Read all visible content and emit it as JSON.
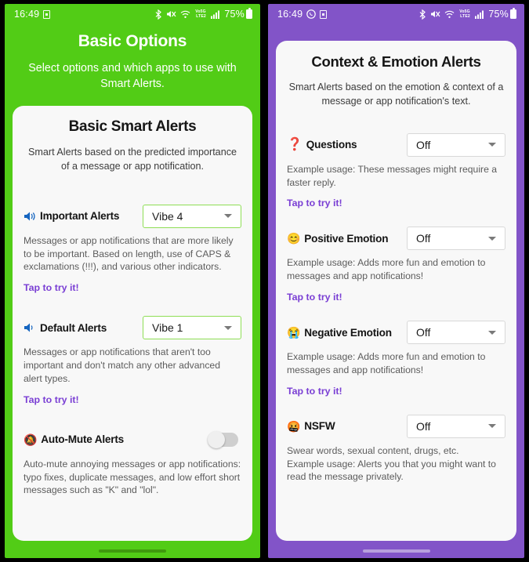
{
  "screens": [
    {
      "id": "basic-options",
      "accent": "#52cc16",
      "status": {
        "clock": "16:49",
        "battery": "75%",
        "network": "Vo5G LTE2 R",
        "icons": [
          "bluetooth-icon",
          "mute-icon",
          "wifi-icon",
          "signal-icon",
          "battery-icon"
        ]
      },
      "header": {
        "title": "Basic Options",
        "subtitle": "Select options and which apps to use with Smart Alerts."
      },
      "card": {
        "title": "Basic Smart Alerts",
        "subtitle": "Smart Alerts based on the predicted importance of a message or app notification."
      },
      "options": [
        {
          "icon": "speaker-loud",
          "emoji": "",
          "label": "Important Alerts",
          "control": "dropdown",
          "value": "Vibe 4",
          "border": "green",
          "description": "Messages or app notifications that are more likely to be important. Based on length, use of CAPS & exclamations (!!!), and various other indicators.",
          "try_label": "Tap to try it!"
        },
        {
          "icon": "speaker-low",
          "emoji": "",
          "label": "Default Alerts",
          "control": "dropdown",
          "value": "Vibe 1",
          "border": "green",
          "description": "Messages or app notifications that aren't too important and don't match any other advanced alert types.",
          "try_label": "Tap to try it!"
        },
        {
          "icon": "bell-slash",
          "emoji": "🔕",
          "label": "Auto-Mute Alerts",
          "control": "toggle",
          "value": "off",
          "description": "Auto-mute annoying messages or app notifications: typo fixes, duplicate messages, and low effort short messages such as \"K\" and \"lol\".",
          "try_label": ""
        }
      ]
    },
    {
      "id": "context-emotion-alerts",
      "accent": "#8254c8",
      "status": {
        "clock": "16:49",
        "battery": "75%",
        "network": "Vo5G LTE2 R",
        "icons": [
          "whatsapp-icon",
          "sim-icon",
          "bluetooth-icon",
          "mute-icon",
          "wifi-icon",
          "signal-icon",
          "battery-icon"
        ]
      },
      "header": {
        "title": "",
        "subtitle": ""
      },
      "card": {
        "title": "Context & Emotion Alerts",
        "subtitle": "Smart Alerts based on the emotion & context of a message or app notification's text."
      },
      "options": [
        {
          "icon": "question-mark",
          "emoji": "❓",
          "label": "Questions",
          "control": "dropdown",
          "value": "Off",
          "border": "gray",
          "description": "Example usage: These messages might require a faster reply.",
          "try_label": "Tap to try it!"
        },
        {
          "icon": "smiling-face",
          "emoji": "😊",
          "label": "Positive Emotion",
          "control": "dropdown",
          "value": "Off",
          "border": "gray",
          "description": "Example usage: Adds more fun and emotion to messages and app notifications!",
          "try_label": "Tap to try it!"
        },
        {
          "icon": "crying-face",
          "emoji": "😭",
          "label": "Negative Emotion",
          "control": "dropdown",
          "value": "Off",
          "border": "gray",
          "description": "Example usage: Adds more fun and emotion to messages and app notifications!",
          "try_label": "Tap to try it!"
        },
        {
          "icon": "cursing-face",
          "emoji": "🤬",
          "label": "NSFW",
          "control": "dropdown",
          "value": "Off",
          "border": "gray",
          "description": "Swear words, sexual content, drugs, etc.\nExample usage: Alerts you that you might want to read the message privately.",
          "try_label": ""
        }
      ]
    }
  ]
}
